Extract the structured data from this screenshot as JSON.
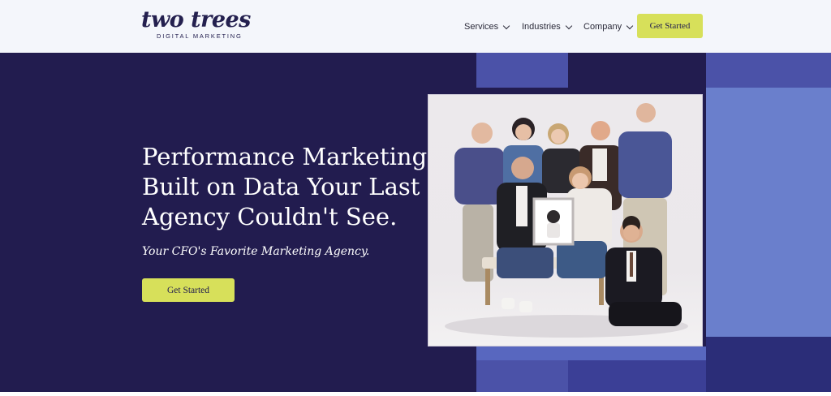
{
  "header": {
    "logo": {
      "name": "two trees",
      "tagline": "DIGITAL MARKETING"
    },
    "nav": [
      {
        "label": "Services",
        "icon": "chevron-down-icon"
      },
      {
        "label": "Industries",
        "icon": "chevron-down-icon"
      },
      {
        "label": "Company",
        "icon": "chevron-down-icon"
      }
    ],
    "cta_label": "Get Started"
  },
  "hero": {
    "headline_lines": [
      "Performance Marketing",
      "Built on Data Your Last",
      "Agency Couldn't See."
    ],
    "tagline": "Your CFO's Favorite Marketing Agency.",
    "cta_label": "Get Started",
    "image": "team-photo"
  },
  "colors": {
    "brand_navy": "#221c4f",
    "accent_lime": "#d7e05a",
    "block_blue": "#4b52a8",
    "block_light": "#6a7fcc",
    "header_bg": "#f4f6fb"
  }
}
